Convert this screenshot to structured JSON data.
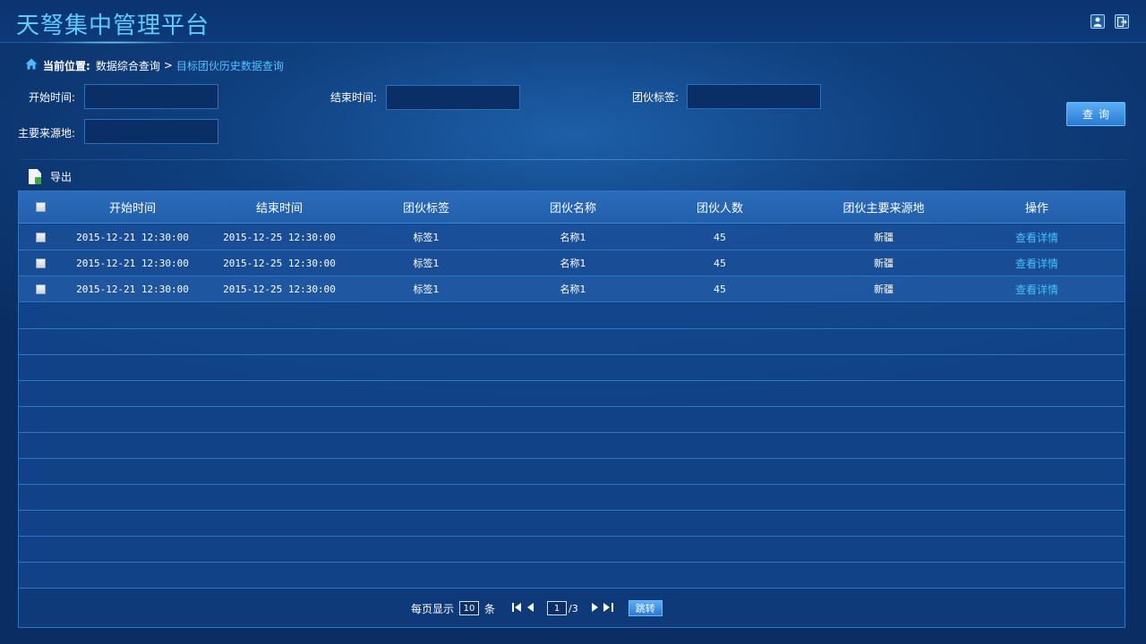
{
  "app": {
    "title": "天弩集中管理平台"
  },
  "header_icons": [
    "user-icon",
    "logout-icon"
  ],
  "breadcrumb": {
    "label": "当前位置:",
    "parent": "数据综合查询",
    "separator": ">",
    "current": "目标团伙历史数据查询"
  },
  "filters": {
    "start_time_label": "开始时间:",
    "end_time_label": "结束时间:",
    "gang_tag_label": "团伙标签:",
    "source_label": "主要来源地:",
    "start_time_value": "",
    "end_time_value": "",
    "gang_tag_value": "",
    "source_value": ""
  },
  "query_button": "查询",
  "toolbar": {
    "export_label": "导出"
  },
  "table": {
    "headers": [
      "开始时间",
      "结束时间",
      "团伙标签",
      "团伙名称",
      "团伙人数",
      "团伙主要来源地",
      "操作"
    ],
    "rows": [
      {
        "start": "2015-12-21  12:30:00",
        "end": "2015-12-25  12:30:00",
        "tag": "标签1",
        "name": "名称1",
        "count": "45",
        "source": "新疆",
        "action": "查看详情"
      },
      {
        "start": "2015-12-21  12:30:00",
        "end": "2015-12-25  12:30:00",
        "tag": "标签1",
        "name": "名称1",
        "count": "45",
        "source": "新疆",
        "action": "查看详情"
      },
      {
        "start": "2015-12-21  12:30:00",
        "end": "2015-12-25  12:30:00",
        "tag": "标签1",
        "name": "名称1",
        "count": "45",
        "source": "新疆",
        "action": "查看详情"
      }
    ]
  },
  "pagination": {
    "per_page_label": "每页显示",
    "per_page_value": "10",
    "per_page_unit": "条",
    "current_page": "1",
    "total_pages": "/3",
    "jump_label": "跳转"
  },
  "colors": {
    "accent": "#4fc3ff",
    "title": "#5ecbff",
    "button": "#3a8ee6"
  }
}
